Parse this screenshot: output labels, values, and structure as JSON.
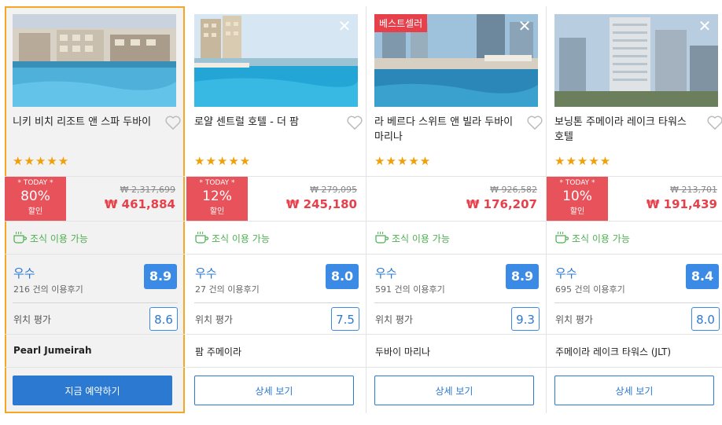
{
  "cards": [
    {
      "name": "니키 비치 리조트 앤 스파 두바이",
      "stars": "★★★★★",
      "today_label": "* TODAY *",
      "discount": "80%",
      "discount_suffix": "할인",
      "old_price": "₩ 2,317,699",
      "price": "₩ 461,884",
      "breakfast": "조식 이용 가능",
      "review_label": "우수",
      "review_count": "216 건의 이용후기",
      "score": "8.9",
      "location_label": "위치 평가",
      "location_score": "8.6",
      "area": "Pearl Jumeirah",
      "button": "지금 예약하기"
    },
    {
      "name": "로얄 센트럴 호텔 - 더 팜",
      "stars": "★★★★★",
      "today_label": "* TODAY *",
      "discount": "12%",
      "discount_suffix": "할인",
      "old_price": "₩ 279,095",
      "price": "₩ 245,180",
      "breakfast": "조식 이용 가능",
      "review_label": "우수",
      "review_count": "27 건의 이용후기",
      "score": "8.0",
      "location_label": "위치 평가",
      "location_score": "7.5",
      "area": "팜 주메이라",
      "button": "상세 보기"
    },
    {
      "name": "라 베르다 스위트 앤 빌라 두바이 마리나",
      "badge": "베스트셀러",
      "stars": "★★★★★",
      "old_price": "₩ 926,582",
      "price": "₩ 176,207",
      "breakfast": "조식 이용 가능",
      "review_label": "우수",
      "review_count": "591 건의 이용후기",
      "score": "8.9",
      "location_label": "위치 평가",
      "location_score": "9.3",
      "area": "두바이 마리나",
      "button": "상세 보기"
    },
    {
      "name": "보닝톤 주메이라 레이크 타워스 호텔",
      "stars": "★★★★★",
      "today_label": "* TODAY *",
      "discount": "10%",
      "discount_suffix": "할인",
      "old_price": "₩ 213,701",
      "price": "₩ 191,439",
      "breakfast": "조식 이용 가능",
      "review_label": "우수",
      "review_count": "695 건의 이용후기",
      "score": "8.4",
      "location_label": "위치 평가",
      "location_score": "8.0",
      "area": "주메이라 레이크 타워스 (JLT)",
      "button": "상세 보기"
    }
  ],
  "colors": {
    "highlight_border": "#f5a623",
    "primary_blue": "#2b79d1",
    "discount_red": "#e8525a",
    "breakfast_green": "#4caf50",
    "star_gold": "#f0a008"
  },
  "icons": {
    "close": "close-icon",
    "favorite": "heart-icon",
    "breakfast": "coffee-cup-icon"
  }
}
